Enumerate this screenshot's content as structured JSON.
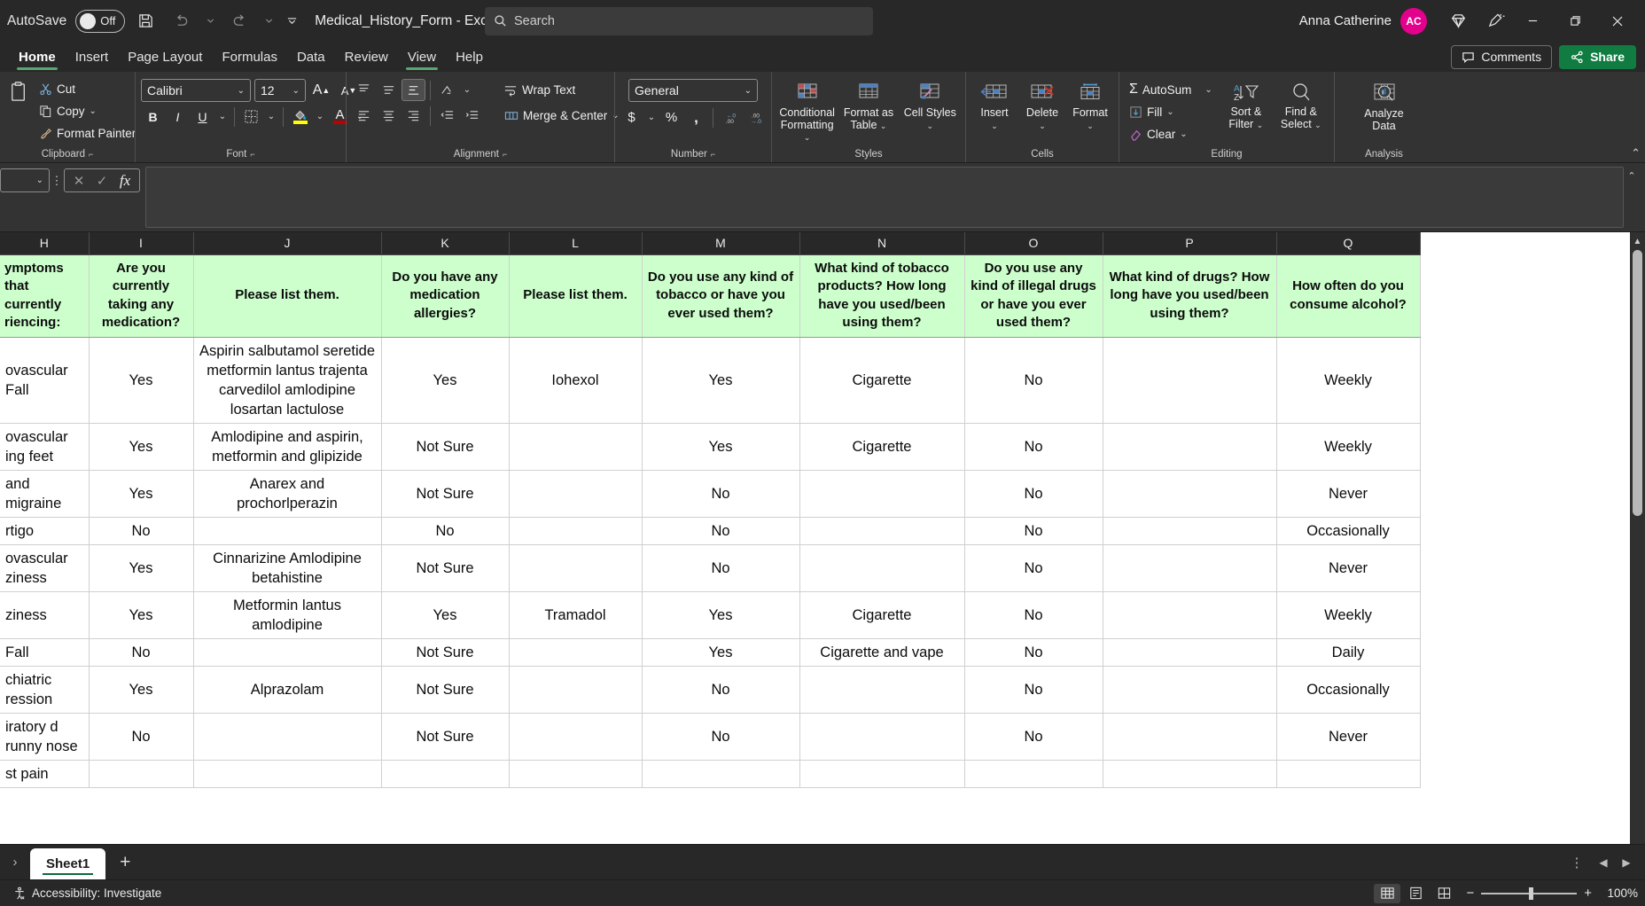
{
  "titlebar": {
    "autosave_label": "AutoSave",
    "autosave_state": "Off",
    "document_title": "Medical_History_Form  -  Excel",
    "search_placeholder": "Search",
    "user_name": "Anna Catherine",
    "user_initials": "AC"
  },
  "tabs": [
    {
      "label": "Home",
      "active": true
    },
    {
      "label": "Insert",
      "active": false
    },
    {
      "label": "Page Layout",
      "active": false
    },
    {
      "label": "Formulas",
      "active": false
    },
    {
      "label": "Data",
      "active": false
    },
    {
      "label": "Review",
      "active": false
    },
    {
      "label": "View",
      "active": false
    },
    {
      "label": "Help",
      "active": false
    }
  ],
  "tabbar_right": {
    "comments_label": "Comments",
    "share_label": "Share"
  },
  "ribbon": {
    "clipboard": {
      "group_label": "Clipboard",
      "cut": "Cut",
      "copy": "Copy",
      "format_painter": "Format Painter"
    },
    "font": {
      "group_label": "Font",
      "font_name": "Calibri",
      "font_size": "12",
      "grow_font": "A",
      "shrink_font": "A",
      "bold": "B",
      "italic": "I",
      "underline": "U"
    },
    "alignment": {
      "group_label": "Alignment",
      "wrap_text": "Wrap Text",
      "merge_center": "Merge & Center"
    },
    "number": {
      "group_label": "Number",
      "format": "General",
      "currency": "$",
      "percent": "%",
      "comma": ","
    },
    "styles": {
      "group_label": "Styles",
      "conditional_formatting": "Conditional Formatting",
      "format_as_table": "Format as Table",
      "cell_styles": "Cell Styles"
    },
    "cells": {
      "group_label": "Cells",
      "insert": "Insert",
      "delete": "Delete",
      "format": "Format"
    },
    "editing": {
      "group_label": "Editing",
      "autosum": "AutoSum",
      "fill": "Fill",
      "clear": "Clear",
      "sort_filter": "Sort & Filter",
      "find_select": "Find & Select"
    },
    "analysis": {
      "group_label": "Analysis",
      "analyze_data": "Analyze Data"
    }
  },
  "formula_bar": {
    "name_box_value": "",
    "formula_value": ""
  },
  "grid": {
    "column_letters": [
      "H",
      "I",
      "J",
      "K",
      "L",
      "M",
      "N",
      "O",
      "P",
      "Q"
    ],
    "headers": [
      "ymptoms that currently riencing:",
      "Are you currently taking any medication?",
      "Please list them.",
      "Do you have any medication allergies?",
      "Please list them.",
      "Do you use any kind of tobacco or have you ever used them?",
      "What kind of tobacco products? How long have you used/been using them?",
      "Do you use any kind of illegal drugs or have you ever used them?",
      "What kind of drugs? How long have you used/been using them?",
      "How often do you consume alcohol?"
    ],
    "rows": [
      [
        "ovascular Fall",
        "Yes",
        "Aspirin salbutamol seretide metformin lantus trajenta carvedilol amlodipine losartan lactulose",
        "Yes",
        "Iohexol",
        "Yes",
        "Cigarette",
        "No",
        "",
        "Weekly"
      ],
      [
        "ovascular ing feet",
        "Yes",
        "Amlodipine and aspirin, metformin and glipizide",
        "Not Sure",
        "",
        "Yes",
        "Cigarette",
        "No",
        "",
        "Weekly"
      ],
      [
        "and migraine",
        "Yes",
        "Anarex and prochorlperazin",
        "Not Sure",
        "",
        "No",
        "",
        "No",
        "",
        "Never"
      ],
      [
        "rtigo",
        "No",
        "",
        "No",
        "",
        "No",
        "",
        "No",
        "",
        "Occasionally"
      ],
      [
        "ovascular ziness",
        "Yes",
        "Cinnarizine Amlodipine betahistine",
        "Not Sure",
        "",
        "No",
        "",
        "No",
        "",
        "Never"
      ],
      [
        "ziness",
        "Yes",
        "Metformin lantus amlodipine",
        "Yes",
        "Tramadol",
        "Yes",
        "Cigarette",
        "No",
        "",
        "Weekly"
      ],
      [
        "Fall",
        "No",
        "",
        "Not Sure",
        "",
        "Yes",
        "Cigarette and vape",
        "No",
        "",
        "Daily"
      ],
      [
        "chiatric ression",
        "Yes",
        "Alprazolam",
        "Not Sure",
        "",
        "No",
        "",
        "No",
        "",
        "Occasionally"
      ],
      [
        "iratory d runny nose",
        "No",
        "",
        "Not Sure",
        "",
        "No",
        "",
        "No",
        "",
        "Never"
      ],
      [
        "st pain",
        "",
        "",
        "",
        "",
        "",
        "",
        "",
        "",
        ""
      ]
    ]
  },
  "sheet_tabs": {
    "tabs": [
      {
        "label": "Sheet1",
        "active": true
      }
    ],
    "add_label": "+"
  },
  "statusbar": {
    "accessibility": "Accessibility: Investigate",
    "zoom_level": "100%"
  },
  "colors": {
    "header_fill": "#CCFFCC",
    "accent_green": "#107C41",
    "avatar": "#E3008C"
  }
}
